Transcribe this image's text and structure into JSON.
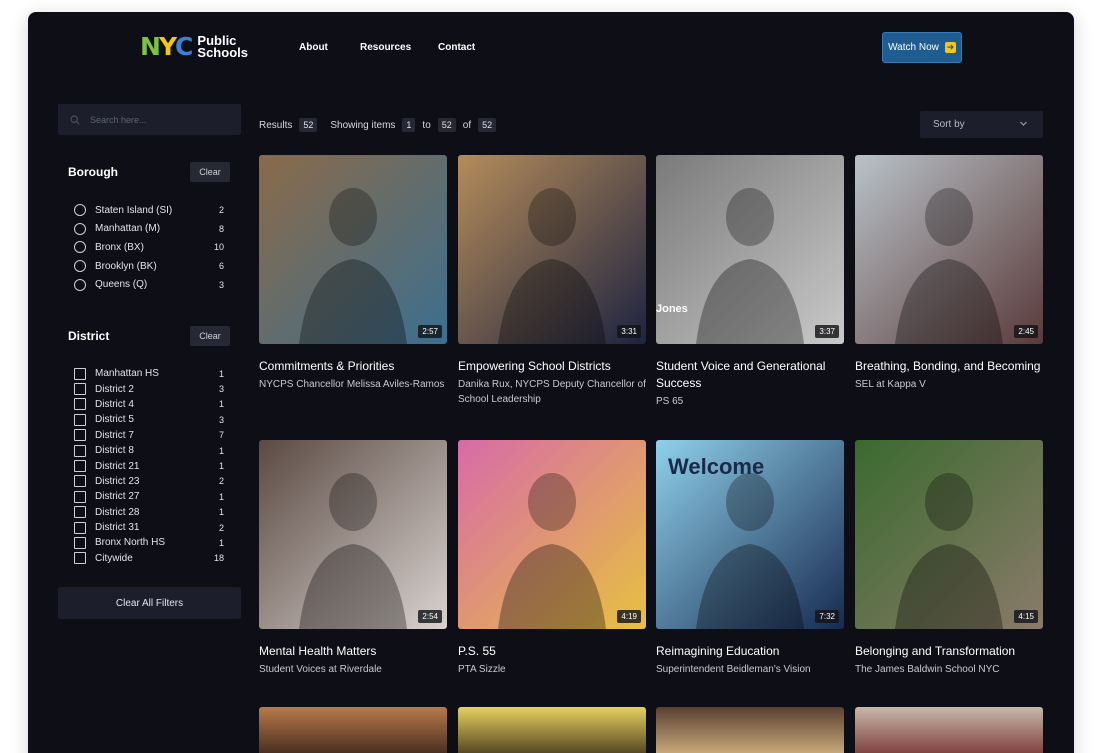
{
  "header": {
    "logo_mark": "NYC",
    "logo_text_line1": "Public",
    "logo_text_line2": "Schools",
    "nav": [
      "About",
      "Resources",
      "Contact"
    ],
    "watch_now_label": "Watch Now",
    "colors": {
      "logo_n": "#7cc244",
      "logo_y": "#f5c518",
      "logo_c": "#3b82d6",
      "watch_bg": "#1f5d91"
    }
  },
  "sidebar": {
    "search_placeholder": "Search here...",
    "borough": {
      "title": "Borough",
      "clear_label": "Clear",
      "options": [
        {
          "label": "Staten Island (SI)",
          "count": "2"
        },
        {
          "label": "Manhattan (M)",
          "count": "8"
        },
        {
          "label": "Bronx (BX)",
          "count": "10"
        },
        {
          "label": "Brooklyn (BK)",
          "count": "6"
        },
        {
          "label": "Queens (Q)",
          "count": "3"
        }
      ]
    },
    "district": {
      "title": "District",
      "clear_label": "Clear",
      "options": [
        {
          "label": "Manhattan HS",
          "count": "1"
        },
        {
          "label": "District 2",
          "count": "3"
        },
        {
          "label": "District 4",
          "count": "1"
        },
        {
          "label": "District 5",
          "count": "3"
        },
        {
          "label": "District 7",
          "count": "7"
        },
        {
          "label": "District 8",
          "count": "1"
        },
        {
          "label": "District 21",
          "count": "1"
        },
        {
          "label": "District 23",
          "count": "2"
        },
        {
          "label": "District 27",
          "count": "1"
        },
        {
          "label": "District 28",
          "count": "1"
        },
        {
          "label": "District 31",
          "count": "2"
        },
        {
          "label": "Bronx North HS",
          "count": "1"
        },
        {
          "label": "Citywide",
          "count": "18"
        }
      ]
    },
    "clear_all_label": "Clear All Filters"
  },
  "results": {
    "results_label": "Results",
    "results_count": "52",
    "showing_label": "Showing items",
    "from": "1",
    "to_label": "to",
    "to": "52",
    "of_label": "of",
    "total": "52",
    "sort_label": "Sort by"
  },
  "videos": [
    {
      "title": "Commitments & Priorities",
      "subtitle": "NYCPS Chancellor Melissa Aviles-Ramos",
      "duration": "2:57",
      "color_a": "#8a6a4a",
      "color_b": "#3c6f8f"
    },
    {
      "title": "Empowering School Districts",
      "subtitle": "Danika Rux, NYCPS Deputy Chancellor of School Leadership",
      "duration": "3:31",
      "color_a": "#b58c5a",
      "color_b": "#1d2340"
    },
    {
      "title": "Student Voice and Generational Success",
      "subtitle": "PS 65",
      "duration": "3:37",
      "color_a": "#7a7a7a",
      "color_b": "#c9c9c9",
      "overlay_text": "Jones"
    },
    {
      "title": "Breathing, Bonding, and Becoming",
      "subtitle": "SEL at Kappa V",
      "duration": "2:45",
      "color_a": "#b9c2c8",
      "color_b": "#5a3a3a"
    },
    {
      "title": "Mental Health Matters",
      "subtitle": "Student Voices at Riverdale",
      "duration": "2:54",
      "color_a": "#5b4a43",
      "color_b": "#d9d3cf"
    },
    {
      "title": "P.S. 55",
      "subtitle": "PTA Sizzle",
      "duration": "4:19",
      "color_a": "#d86aa8",
      "color_b": "#e7c140"
    },
    {
      "title": "Reimagining Education",
      "subtitle": "Superintendent Beidleman's Vision",
      "duration": "7:32",
      "color_a": "#8fd0ea",
      "color_b": "#172a50",
      "overlay_text": "Welcome"
    },
    {
      "title": "Belonging and Transformation",
      "subtitle": "The James Baldwin School NYC",
      "duration": "4:15",
      "color_a": "#3a6a2e",
      "color_b": "#8a7a6a"
    }
  ],
  "partial_thumbs": [
    {
      "color_a": "#b87a4a",
      "color_b": "#2a1a14"
    },
    {
      "color_a": "#e8d060",
      "color_b": "#2a2010"
    },
    {
      "color_a": "#5a4030",
      "color_b": "#e8c890"
    },
    {
      "color_a": "#c8b8a8",
      "color_b": "#6a2020"
    }
  ]
}
